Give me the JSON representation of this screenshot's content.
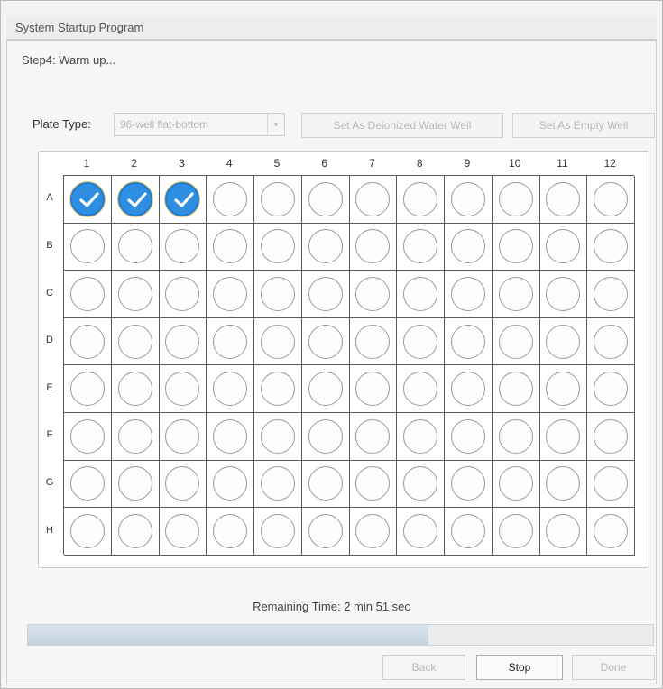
{
  "window": {
    "title": "System Startup Program"
  },
  "step_text": "Step4:  Warm up...",
  "plate": {
    "label": "Plate Type:",
    "selected_type": "96-well flat-bottom",
    "set_deionized_water_button": "Set As Deionized Water Well",
    "set_empty_button": "Set As Empty Well",
    "columns": [
      "1",
      "2",
      "3",
      "4",
      "5",
      "6",
      "7",
      "8",
      "9",
      "10",
      "11",
      "12"
    ],
    "rows": [
      "A",
      "B",
      "C",
      "D",
      "E",
      "F",
      "G",
      "H"
    ],
    "selected_wells": [
      "A1",
      "A2",
      "A3"
    ],
    "selected_color": "#2e8fe2"
  },
  "remaining_time": "Remaining Time: 2 min 51 sec",
  "progress_fraction": 0.64,
  "buttons": {
    "back": "Back",
    "stop": "Stop",
    "done": "Done"
  },
  "icons": {
    "well_selected": "check-icon",
    "dropdown": "chevron-down-icon"
  }
}
